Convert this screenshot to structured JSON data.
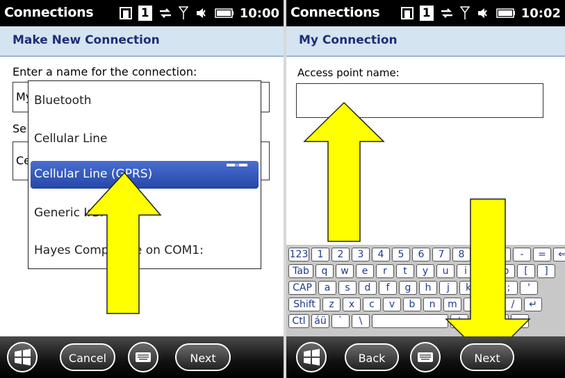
{
  "screen1": {
    "status_title": "Connections",
    "status_box": "1",
    "status_time": "10:00",
    "page_title": "Make New Connection",
    "name_label": "Enter a name for the connection:",
    "name_value": "My",
    "select_label": "Se",
    "select_value": "Ce",
    "dropdown": {
      "items": [
        "Bluetooth",
        "Cellular Line",
        "Cellular Line (GPRS)",
        "Generic IrDA",
        "Hayes Compatible on COM1:"
      ],
      "selected_index": 2
    },
    "softkeys": {
      "left": "Cancel",
      "right": "Next"
    }
  },
  "screen2": {
    "status_title": "Connections",
    "status_box": "1",
    "status_time": "10:02",
    "page_title": "My Connection",
    "apn_label": "Access point name:",
    "apn_value": "",
    "keyboard": {
      "row1": [
        "123",
        "1",
        "2",
        "3",
        "4",
        "5",
        "6",
        "7",
        "8",
        "9",
        "0",
        "-",
        "=",
        "⇐"
      ],
      "row2": [
        "Tab",
        "q",
        "w",
        "e",
        "r",
        "t",
        "y",
        "u",
        "i",
        "o",
        "p",
        "[",
        "]"
      ],
      "row3": [
        "CAP",
        "a",
        "s",
        "d",
        "f",
        "g",
        "h",
        "j",
        "k",
        "l",
        ";",
        "'"
      ],
      "row4": [
        "Shift",
        "z",
        "x",
        "c",
        "v",
        "b",
        "n",
        "m",
        ",",
        ".",
        "/",
        "↵"
      ],
      "row5": [
        "Ctl",
        "áü",
        "`",
        "\\",
        "",
        "↓",
        "↑",
        "←",
        "→"
      ]
    },
    "softkeys": {
      "left": "Back",
      "right": "Next"
    }
  },
  "colors": {
    "title_text": "#1d2e76",
    "title_bg": "#d4e4f0",
    "highlight": "#2f52b8",
    "arrow_fill": "#ffff00"
  }
}
